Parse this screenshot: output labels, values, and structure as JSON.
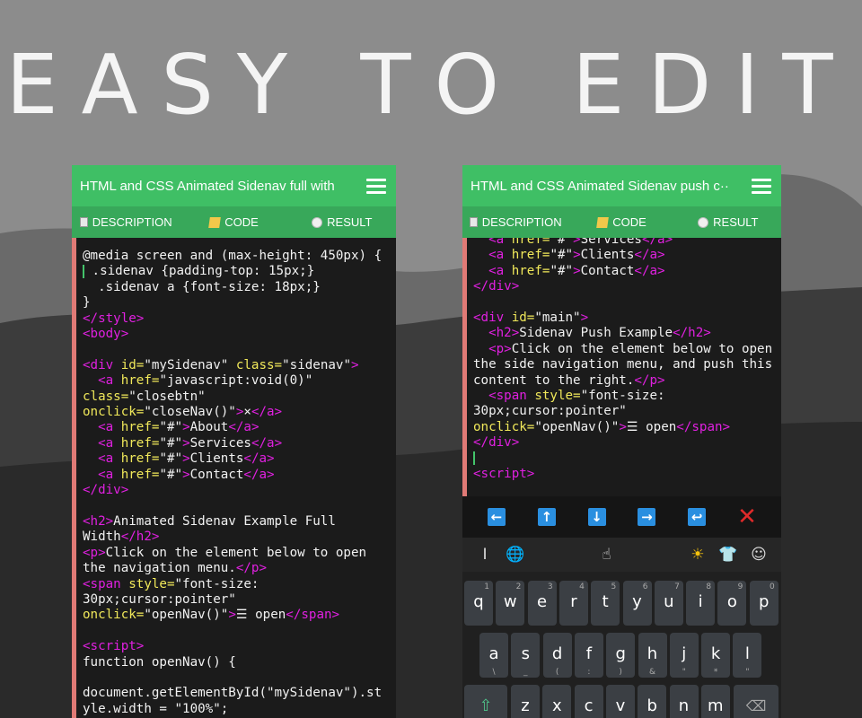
{
  "headline": "EASY TO EDIT",
  "left_phone": {
    "title": "HTML and CSS Animated Sidenav full with",
    "tabs": [
      {
        "icon": "description-icon",
        "label": "DESCRIPTION"
      },
      {
        "icon": "code-icon",
        "label": "CODE"
      },
      {
        "icon": "result-icon",
        "label": "RESULT"
      }
    ]
  },
  "right_phone": {
    "title": "HTML and CSS Animated Sidenav push c··",
    "tabs": [
      {
        "icon": "description-icon",
        "label": "DESCRIPTION"
      },
      {
        "icon": "code-icon",
        "label": "CODE"
      },
      {
        "icon": "result-icon",
        "label": "RESULT"
      }
    ],
    "toolbar": [
      {
        "name": "arrow-left-button",
        "glyph": "←"
      },
      {
        "name": "arrow-up-button",
        "glyph": "↑"
      },
      {
        "name": "arrow-down-button",
        "glyph": "↓"
      },
      {
        "name": "arrow-right-button",
        "glyph": "→"
      },
      {
        "name": "return-button",
        "glyph": "↩"
      },
      {
        "name": "close-editor-button",
        "glyph": "✕"
      }
    ],
    "keyboard": {
      "row1": [
        {
          "k": "q",
          "h": "1"
        },
        {
          "k": "w",
          "h": "2"
        },
        {
          "k": "e",
          "h": "3"
        },
        {
          "k": "r",
          "h": "4"
        },
        {
          "k": "t",
          "h": "5"
        },
        {
          "k": "y",
          "h": "6"
        },
        {
          "k": "u",
          "h": "7"
        },
        {
          "k": "i",
          "h": "8"
        },
        {
          "k": "o",
          "h": "9"
        },
        {
          "k": "p",
          "h": "0"
        }
      ],
      "row2": [
        {
          "k": "a",
          "s": "\\"
        },
        {
          "k": "s",
          "s": "_"
        },
        {
          "k": "d",
          "s": "("
        },
        {
          "k": "f",
          "s": ":"
        },
        {
          "k": "g",
          "s": ")"
        },
        {
          "k": "h",
          "s": "&"
        },
        {
          "k": "j",
          "s": "\""
        },
        {
          "k": "k",
          "s": "*"
        },
        {
          "k": "l",
          "s": "\""
        }
      ],
      "row3": [
        {
          "k": "z",
          "s": "@"
        },
        {
          "k": "x",
          "s": "#"
        },
        {
          "k": "c",
          "s": "$"
        },
        {
          "k": "v",
          "s": "%"
        },
        {
          "k": "b",
          "s": "!"
        },
        {
          "k": "n",
          "s": "?"
        },
        {
          "k": "m",
          "s": "'"
        }
      ]
    }
  }
}
